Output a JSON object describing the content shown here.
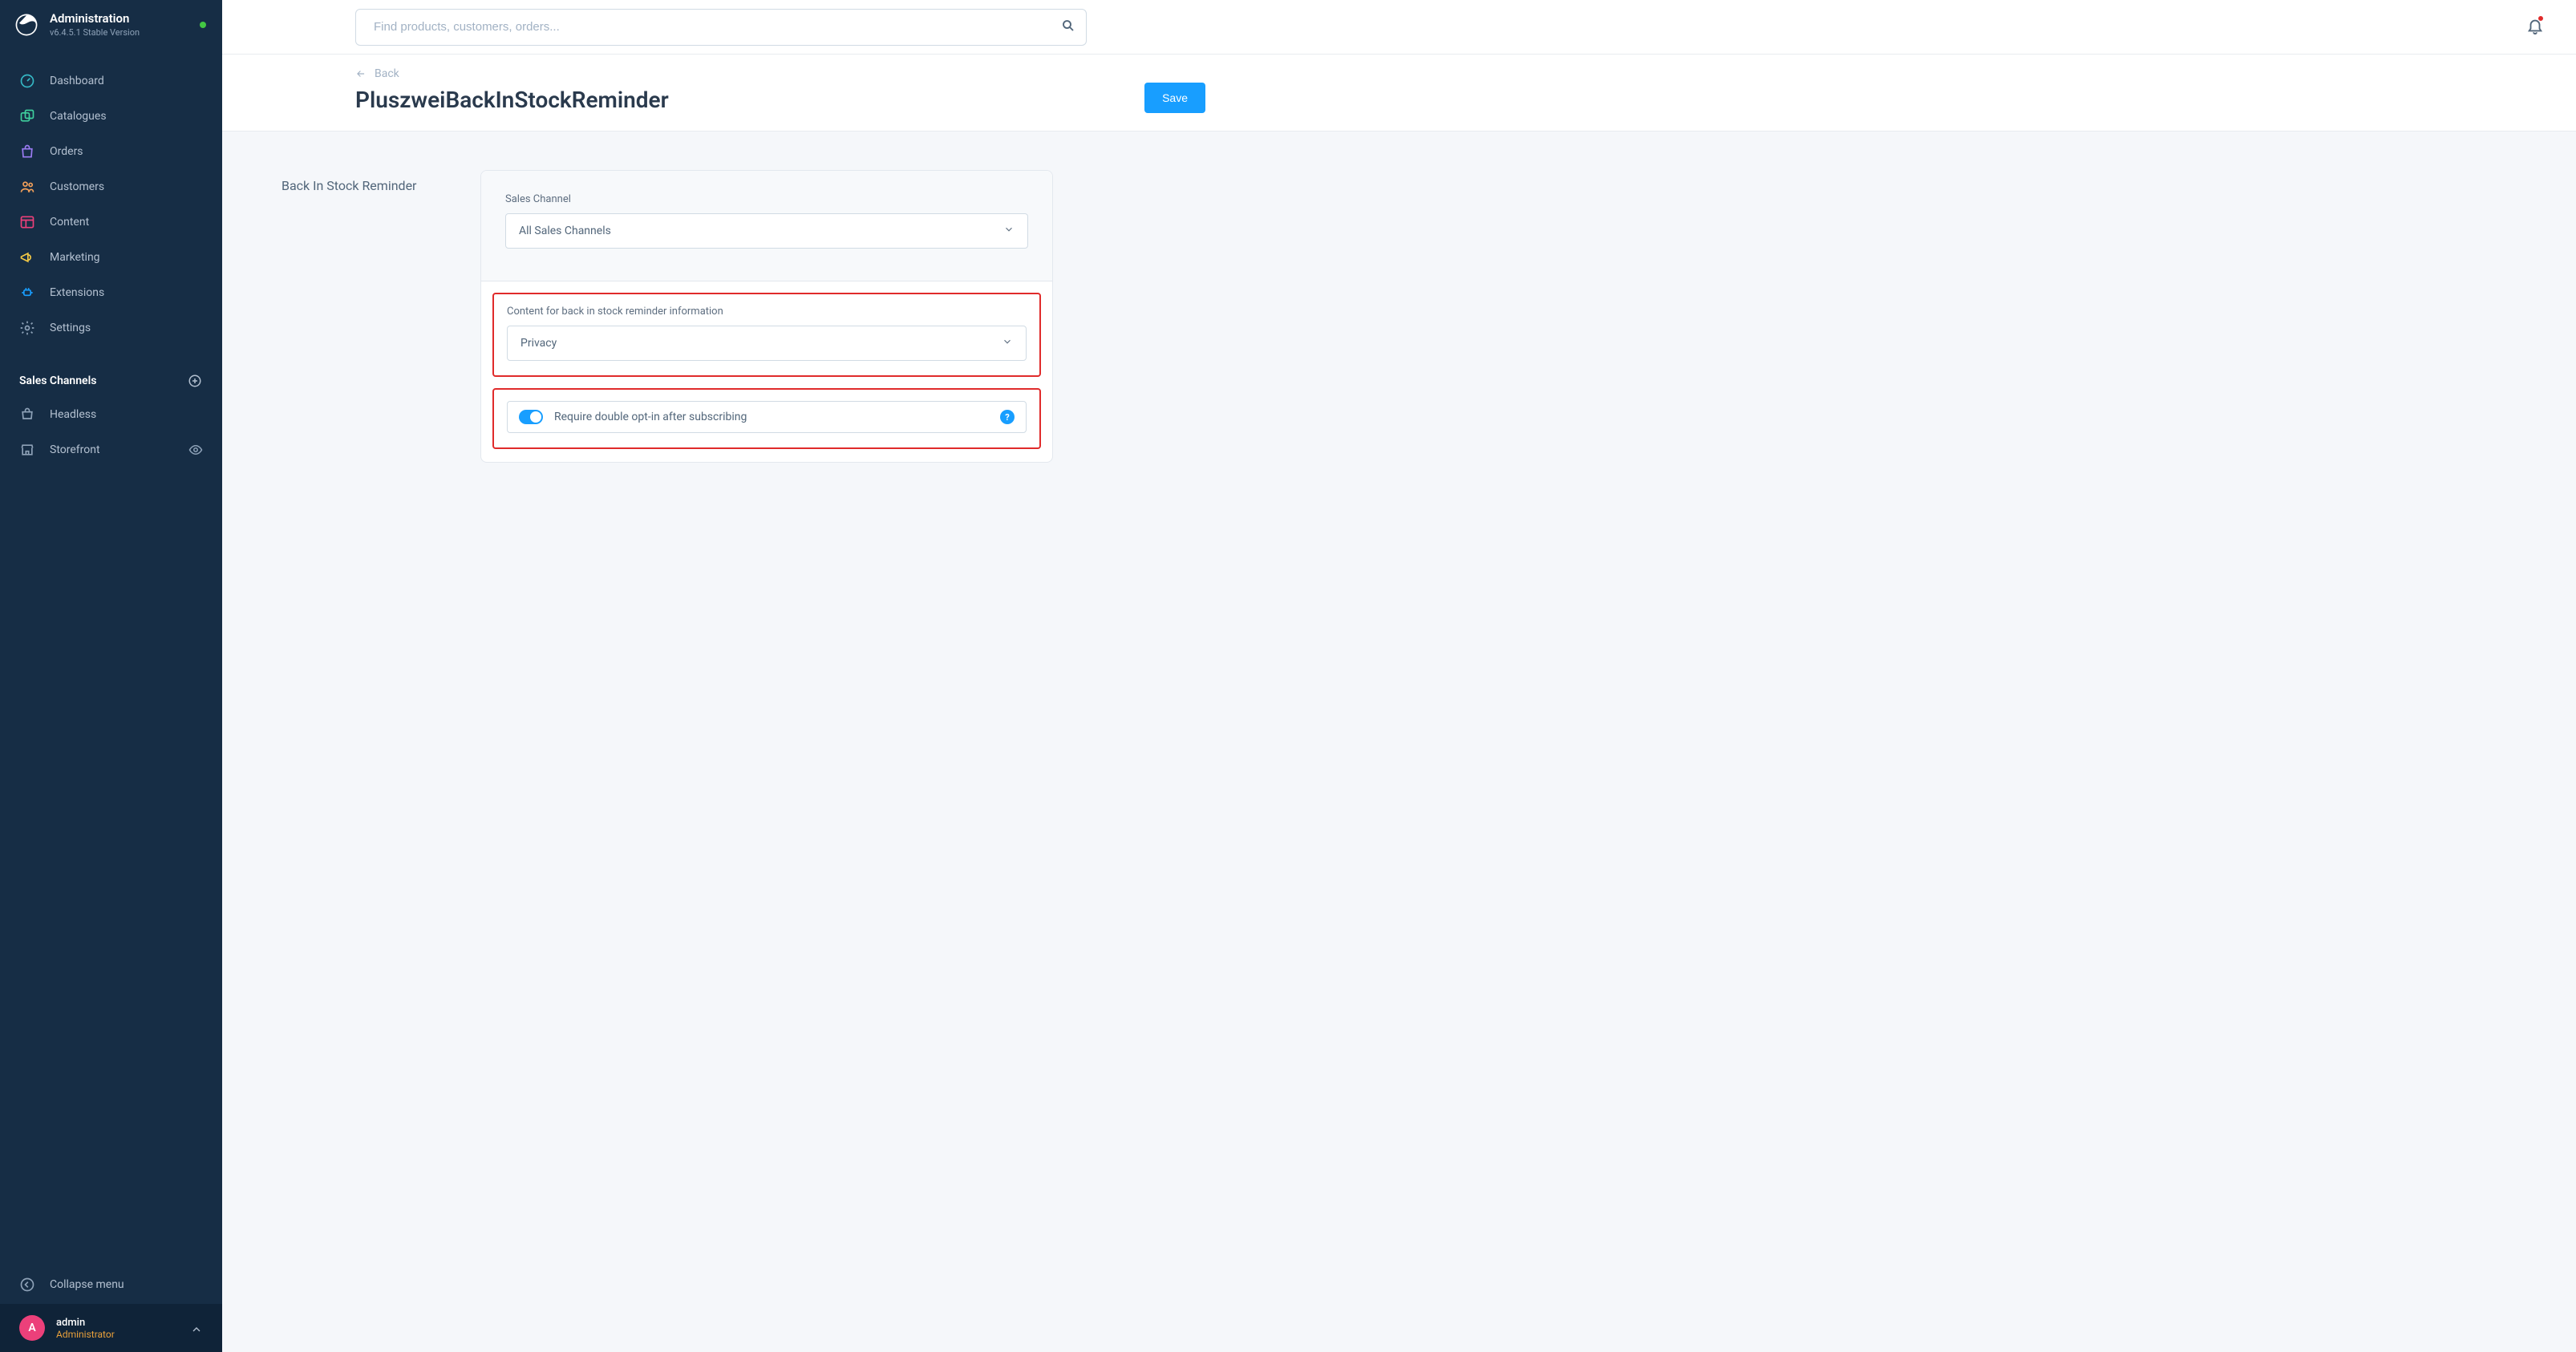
{
  "app": {
    "title": "Administration",
    "version": "v6.4.5.1 Stable Version"
  },
  "search": {
    "placeholder": "Find products, customers, orders..."
  },
  "nav": {
    "items": [
      {
        "label": "Dashboard"
      },
      {
        "label": "Catalogues"
      },
      {
        "label": "Orders"
      },
      {
        "label": "Customers"
      },
      {
        "label": "Content"
      },
      {
        "label": "Marketing"
      },
      {
        "label": "Extensions"
      },
      {
        "label": "Settings"
      }
    ],
    "section_title": "Sales Channels",
    "channels": [
      {
        "label": "Headless"
      },
      {
        "label": "Storefront"
      }
    ],
    "collapse_label": "Collapse menu"
  },
  "user": {
    "avatar_initial": "A",
    "name": "admin",
    "role": "Administrator"
  },
  "page": {
    "back_label": "Back",
    "title": "PluszweiBackInStockReminder",
    "save_label": "Save"
  },
  "card": {
    "heading": "Back In Stock Reminder",
    "sales_channel": {
      "label": "Sales Channel",
      "value": "All Sales Channels"
    },
    "content_field": {
      "label": "Content for back in stock reminder information",
      "value": "Privacy"
    },
    "double_opt_in": {
      "label": "Require double opt-in after subscribing",
      "enabled": true,
      "help": "?"
    }
  }
}
